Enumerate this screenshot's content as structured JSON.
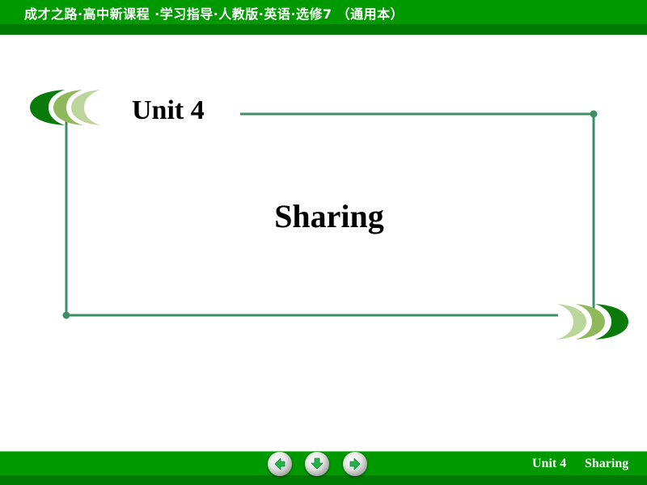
{
  "header": {
    "title": "成才之路·高中新课程 ·学习指导·人教版·英语·选修7 （通用本）"
  },
  "slide": {
    "unit_title": "Unit 4",
    "lesson_title": "Sharing"
  },
  "footer": {
    "unit_label": "Unit 4",
    "lesson_label": "Sharing",
    "nav": {
      "prev_icon": "arrow-left-icon",
      "home_icon": "arrow-down-icon",
      "next_icon": "arrow-right-icon"
    }
  },
  "colors": {
    "bar_green": "#009900",
    "bar_dark_green": "#007a00",
    "frame_line": "#3c8f64",
    "leaf_dark": "#0a7a0a",
    "leaf_mid": "#8fb85a",
    "leaf_light": "#bcd59a"
  }
}
